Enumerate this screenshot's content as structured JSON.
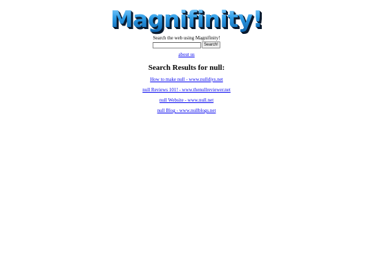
{
  "logo": {
    "text": "Magnifinity!"
  },
  "search": {
    "caption": "Search the web using Magnifinity!",
    "input_value": "",
    "button_label": "Search!"
  },
  "about": {
    "label": "about us"
  },
  "results": {
    "heading": "Search Results for null:",
    "items": [
      {
        "label": "How to make null - www.nulldiys.net"
      },
      {
        "label": "null Reviews 101! - www.thenullreviewer.net"
      },
      {
        "label": "null Website - www.null.net"
      },
      {
        "label": "null Blog - www.nullblogs.net"
      }
    ]
  },
  "colors": {
    "link": "#0000ee",
    "logo_blue": "#2e9ce6",
    "logo_shadow": "#0a1a2e",
    "background": "#ffffff"
  }
}
